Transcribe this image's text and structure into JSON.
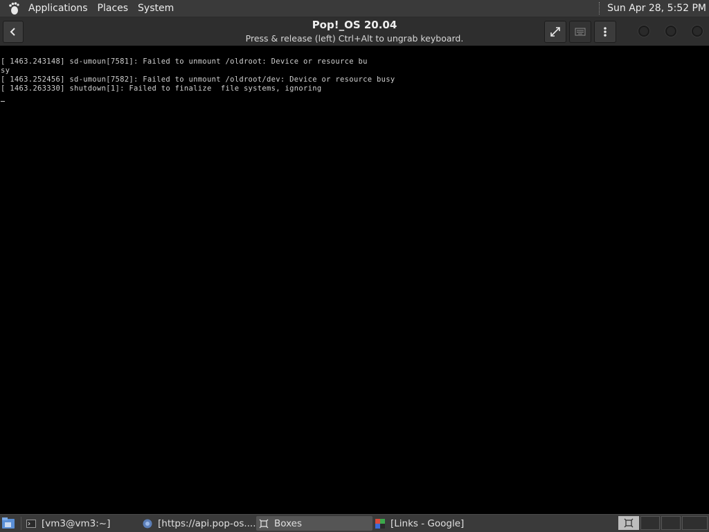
{
  "top_panel": {
    "menus": [
      "Applications",
      "Places",
      "System"
    ],
    "clock": "Sun Apr 28,  5:52 PM",
    "logo_icon": "gnome-foot-icon"
  },
  "headerbar": {
    "title": "Pop!_OS 20.04",
    "subtitle": "Press & release (left) Ctrl+Alt to ungrab keyboard.",
    "icons": {
      "back": "chevron-left-icon",
      "fullscreen": "fullscreen-icon",
      "keyboard": "keyboard-icon",
      "menu": "kebab-menu-icon"
    }
  },
  "console": {
    "lines": [
      "[ 1463.243148] sd-umoun[7581]: Failed to unmount /oldroot: Device or resource bu",
      "sy",
      "[ 1463.252456] sd-umoun[7582]: Failed to unmount /oldroot/dev: Device or resource busy",
      "[ 1463.263330] shutdown[1]: Failed to finalize  file systems, ignoring"
    ]
  },
  "taskbar": {
    "tasks": [
      {
        "label": "[vm3@vm3:~]",
        "icon": "terminal-icon"
      },
      {
        "label": "[https://api.pop-os....",
        "icon": "chrome-icon"
      },
      {
        "label": "Boxes",
        "icon": "boxes-icon",
        "active": true
      },
      {
        "label": "[Links - Google]",
        "icon": "links-browser-icon"
      }
    ]
  },
  "colors": {
    "panel": "#3a3a3a",
    "headerbar": "#2e2e2e",
    "console_bg": "#000000",
    "console_text": "#d0d0d0"
  }
}
